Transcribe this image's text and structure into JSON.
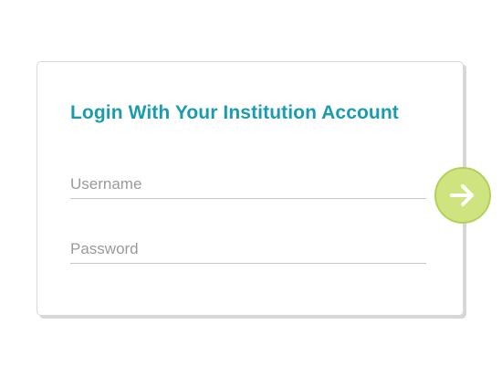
{
  "login": {
    "title": "Login With Your Institution Account",
    "username_placeholder": "Username",
    "password_placeholder": "Password",
    "submit_icon": "arrow-right-icon"
  },
  "colors": {
    "title": "#1a9bb0",
    "submit_fill": "#cfe37f",
    "submit_border": "#b5cf5c",
    "arrow": "#ffffff"
  }
}
